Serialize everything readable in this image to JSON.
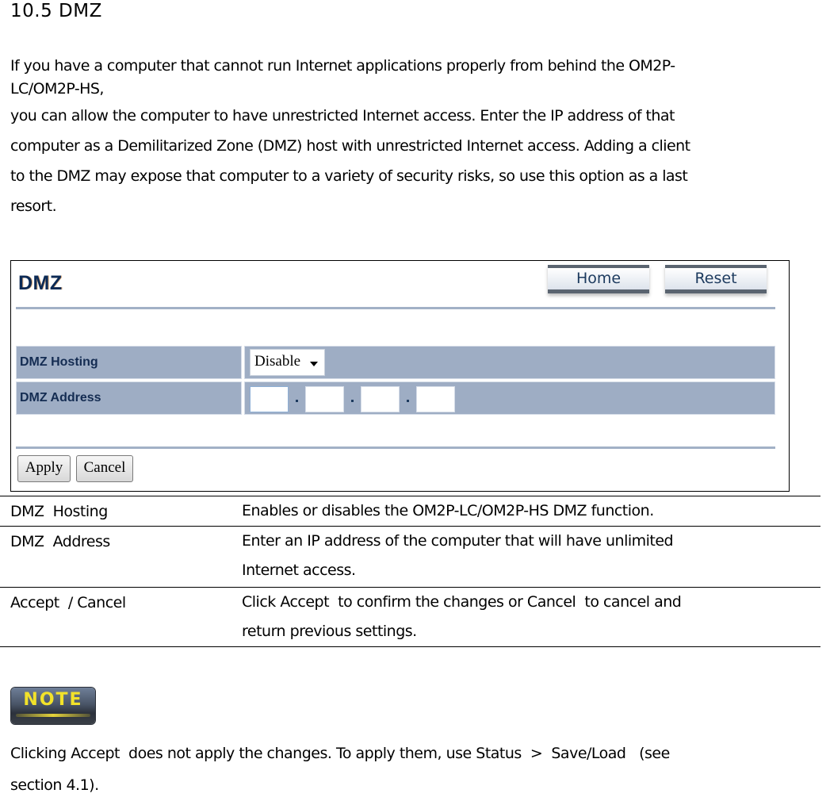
{
  "heading": "10.5  DMZ",
  "intro": {
    "line1": "If you have a computer that cannot run Internet applications properly from behind the OM2P-",
    "line2": "LC/OM2P-HS,",
    "line3": "you can allow the computer to have unrestricted Internet access. Enter the IP address of that",
    "line4": "computer as a Demilitarized Zone (DMZ) host with unrestricted Internet access. Adding a client",
    "line5": "to the DMZ may expose that computer to a variety of security risks, so use this option as a last",
    "line6": "resort."
  },
  "panel": {
    "title": "DMZ",
    "home_label": "Home",
    "reset_label": "Reset",
    "rows": [
      {
        "label": "DMZ Hosting",
        "value": "Disable"
      },
      {
        "label": "DMZ Address",
        "ip": [
          "",
          "",
          "",
          ""
        ],
        "separator": "."
      }
    ],
    "apply_label": "Apply",
    "cancel_label": "Cancel",
    "colors": {
      "row_bg": "#9eadc4",
      "title": "#0b2a55",
      "rule": "#a2b1c6"
    }
  },
  "descriptions": [
    {
      "term": "DMZ  Hosting",
      "lines": [
        "Enables or disables the OM2P-LC/OM2P-HS DMZ function."
      ]
    },
    {
      "term": "DMZ  Address",
      "lines": [
        "Enter an IP address of the computer that will have unlimited",
        "Internet access."
      ]
    },
    {
      "term": "Accept  / Cancel",
      "lines": [
        "Click Accept  to confirm the changes or Cancel  to cancel and",
        "return previous settings."
      ]
    }
  ],
  "note": {
    "badge": "NOTE",
    "line1": "Clicking Accept  does not apply the changes. To apply them, use Status  >  Save/Load   (see",
    "line2": "section 4.1)."
  }
}
